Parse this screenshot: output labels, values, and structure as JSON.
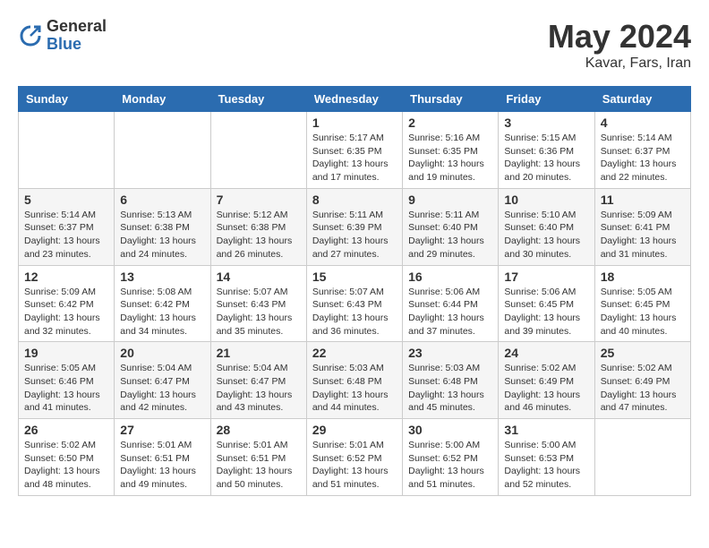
{
  "logo": {
    "general": "General",
    "blue": "Blue"
  },
  "title": "May 2024",
  "location": "Kavar, Fars, Iran",
  "days_of_week": [
    "Sunday",
    "Monday",
    "Tuesday",
    "Wednesday",
    "Thursday",
    "Friday",
    "Saturday"
  ],
  "weeks": [
    [
      {
        "day": "",
        "info": ""
      },
      {
        "day": "",
        "info": ""
      },
      {
        "day": "",
        "info": ""
      },
      {
        "day": "1",
        "info": "Sunrise: 5:17 AM\nSunset: 6:35 PM\nDaylight: 13 hours\nand 17 minutes."
      },
      {
        "day": "2",
        "info": "Sunrise: 5:16 AM\nSunset: 6:35 PM\nDaylight: 13 hours\nand 19 minutes."
      },
      {
        "day": "3",
        "info": "Sunrise: 5:15 AM\nSunset: 6:36 PM\nDaylight: 13 hours\nand 20 minutes."
      },
      {
        "day": "4",
        "info": "Sunrise: 5:14 AM\nSunset: 6:37 PM\nDaylight: 13 hours\nand 22 minutes."
      }
    ],
    [
      {
        "day": "5",
        "info": "Sunrise: 5:14 AM\nSunset: 6:37 PM\nDaylight: 13 hours\nand 23 minutes."
      },
      {
        "day": "6",
        "info": "Sunrise: 5:13 AM\nSunset: 6:38 PM\nDaylight: 13 hours\nand 24 minutes."
      },
      {
        "day": "7",
        "info": "Sunrise: 5:12 AM\nSunset: 6:38 PM\nDaylight: 13 hours\nand 26 minutes."
      },
      {
        "day": "8",
        "info": "Sunrise: 5:11 AM\nSunset: 6:39 PM\nDaylight: 13 hours\nand 27 minutes."
      },
      {
        "day": "9",
        "info": "Sunrise: 5:11 AM\nSunset: 6:40 PM\nDaylight: 13 hours\nand 29 minutes."
      },
      {
        "day": "10",
        "info": "Sunrise: 5:10 AM\nSunset: 6:40 PM\nDaylight: 13 hours\nand 30 minutes."
      },
      {
        "day": "11",
        "info": "Sunrise: 5:09 AM\nSunset: 6:41 PM\nDaylight: 13 hours\nand 31 minutes."
      }
    ],
    [
      {
        "day": "12",
        "info": "Sunrise: 5:09 AM\nSunset: 6:42 PM\nDaylight: 13 hours\nand 32 minutes."
      },
      {
        "day": "13",
        "info": "Sunrise: 5:08 AM\nSunset: 6:42 PM\nDaylight: 13 hours\nand 34 minutes."
      },
      {
        "day": "14",
        "info": "Sunrise: 5:07 AM\nSunset: 6:43 PM\nDaylight: 13 hours\nand 35 minutes."
      },
      {
        "day": "15",
        "info": "Sunrise: 5:07 AM\nSunset: 6:43 PM\nDaylight: 13 hours\nand 36 minutes."
      },
      {
        "day": "16",
        "info": "Sunrise: 5:06 AM\nSunset: 6:44 PM\nDaylight: 13 hours\nand 37 minutes."
      },
      {
        "day": "17",
        "info": "Sunrise: 5:06 AM\nSunset: 6:45 PM\nDaylight: 13 hours\nand 39 minutes."
      },
      {
        "day": "18",
        "info": "Sunrise: 5:05 AM\nSunset: 6:45 PM\nDaylight: 13 hours\nand 40 minutes."
      }
    ],
    [
      {
        "day": "19",
        "info": "Sunrise: 5:05 AM\nSunset: 6:46 PM\nDaylight: 13 hours\nand 41 minutes."
      },
      {
        "day": "20",
        "info": "Sunrise: 5:04 AM\nSunset: 6:47 PM\nDaylight: 13 hours\nand 42 minutes."
      },
      {
        "day": "21",
        "info": "Sunrise: 5:04 AM\nSunset: 6:47 PM\nDaylight: 13 hours\nand 43 minutes."
      },
      {
        "day": "22",
        "info": "Sunrise: 5:03 AM\nSunset: 6:48 PM\nDaylight: 13 hours\nand 44 minutes."
      },
      {
        "day": "23",
        "info": "Sunrise: 5:03 AM\nSunset: 6:48 PM\nDaylight: 13 hours\nand 45 minutes."
      },
      {
        "day": "24",
        "info": "Sunrise: 5:02 AM\nSunset: 6:49 PM\nDaylight: 13 hours\nand 46 minutes."
      },
      {
        "day": "25",
        "info": "Sunrise: 5:02 AM\nSunset: 6:49 PM\nDaylight: 13 hours\nand 47 minutes."
      }
    ],
    [
      {
        "day": "26",
        "info": "Sunrise: 5:02 AM\nSunset: 6:50 PM\nDaylight: 13 hours\nand 48 minutes."
      },
      {
        "day": "27",
        "info": "Sunrise: 5:01 AM\nSunset: 6:51 PM\nDaylight: 13 hours\nand 49 minutes."
      },
      {
        "day": "28",
        "info": "Sunrise: 5:01 AM\nSunset: 6:51 PM\nDaylight: 13 hours\nand 50 minutes."
      },
      {
        "day": "29",
        "info": "Sunrise: 5:01 AM\nSunset: 6:52 PM\nDaylight: 13 hours\nand 51 minutes."
      },
      {
        "day": "30",
        "info": "Sunrise: 5:00 AM\nSunset: 6:52 PM\nDaylight: 13 hours\nand 51 minutes."
      },
      {
        "day": "31",
        "info": "Sunrise: 5:00 AM\nSunset: 6:53 PM\nDaylight: 13 hours\nand 52 minutes."
      },
      {
        "day": "",
        "info": ""
      }
    ]
  ]
}
